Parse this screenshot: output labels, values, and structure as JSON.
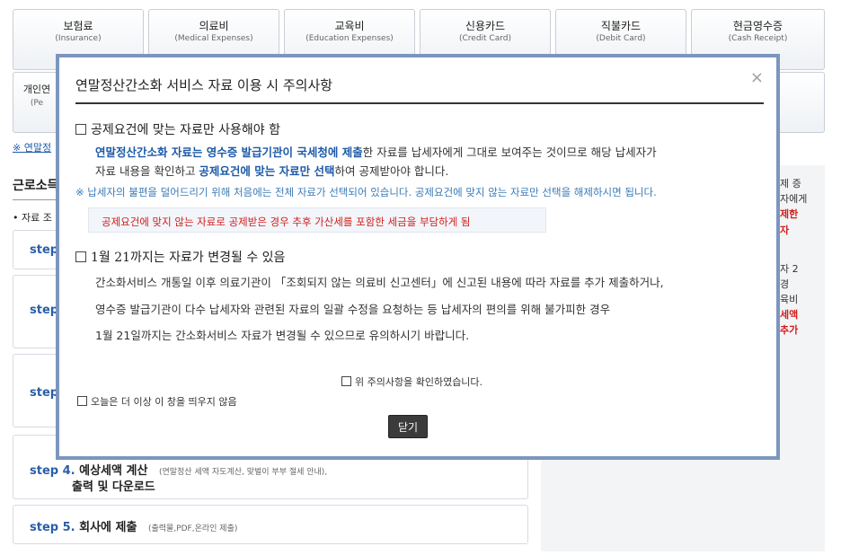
{
  "categories_row1": [
    {
      "ko": "보험료",
      "en": "(Insurance)"
    },
    {
      "ko": "의료비",
      "en": "(Medical Expenses)"
    },
    {
      "ko": "교육비",
      "en": "(Education Expenses)"
    },
    {
      "ko": "신용카드",
      "en": "(Credit Card)"
    },
    {
      "ko": "직불카드",
      "en": "(Debit Card)"
    },
    {
      "ko": "현금영수증",
      "en": "(Cash Receipt)"
    }
  ],
  "categories_row2_partial": {
    "ko": "개인연",
    "en": "(Pe"
  },
  "background": {
    "notice_link": "※ 연말정",
    "section_title": "근로소득",
    "sub_bullet": "• 자료 조",
    "steps": [
      {
        "label": "step",
        "title": "",
        "desc": ""
      },
      {
        "label": "step",
        "title": "",
        "desc": ""
      },
      {
        "label": "step",
        "title": "",
        "desc": ""
      },
      {
        "label": "step 4.",
        "title": "예상세액 계산",
        "desc": "(연말정산 세액 자도계산, 맞벌이 부부 절세 안내),",
        "title2": "출력 및 다운로드"
      },
      {
        "label": "step 5.",
        "title": "회사에 제출",
        "desc": "(출력물,PDF,온라인 제출)"
      }
    ],
    "side_fragments": [
      {
        "text": "제 증",
        "red": false
      },
      {
        "text": "자에게",
        "red": false
      },
      {
        "text": "제한",
        "red": true
      },
      {
        "text": "자",
        "red": true
      },
      {
        "text": "자 2",
        "red": false
      },
      {
        "text": "경",
        "red": false
      },
      {
        "text": "육비",
        "red": false
      },
      {
        "text": "세액",
        "red": true
      },
      {
        "text": "추가",
        "red": true
      }
    ]
  },
  "modal": {
    "title": "연말정산간소화 서비스 자료 이용 시 주의사항",
    "close_icon": "×",
    "section1": {
      "heading": "공제요건에 맞는 자료만 사용해야 함",
      "p1_hl": "연말정산간소화 자료는 영수증 발급기관이 국세청에 제출",
      "p1_rest": "한 자료를 납세자에게 그대로 보여주는 것이므로 해당 납세자가",
      "p2_start": "자료 내용을 확인하고 ",
      "p2_hl": "공제요건에 맞는 자료만 선택",
      "p2_end": "하여 공제받아야 합니다.",
      "tip": "※ 납세자의 불편을 덜어드리기 위해 처음에는 전체 자료가 선택되어 있습니다. 공제요건에 맞지 않는 자료만 선택을 해제하시면 됩니다.",
      "warning": "공제요건에 맞지 않는 자료로 공제받은 경우 추후 가산세를 포함한 세금을 부담하게 됨"
    },
    "section2": {
      "heading": "1월 21까지는 자료가 변경될 수 있음",
      "lines": [
        "간소화서비스 개통일 이후 의료기관이 「조회되지 않는 의료비 신고센터」에 신고된 내용에 따라 자료를 추가 제출하거나,",
        "영수증 발급기관이 다수 납세자와 관련된 자료의 일괄 수정을 요청하는 등 납세자의 편의를 위해 불가피한 경우",
        "1월 21일까지는 간소화서비스 자료가 변경될 수 있으므로 유의하시기 바랍니다."
      ]
    },
    "confirm_checkbox_label": "위 주의사항을 확인하였습니다.",
    "no_show_checkbox_label": "오늘은 더 이상 이 창을 띄우지 않음",
    "close_button_label": "닫기"
  }
}
